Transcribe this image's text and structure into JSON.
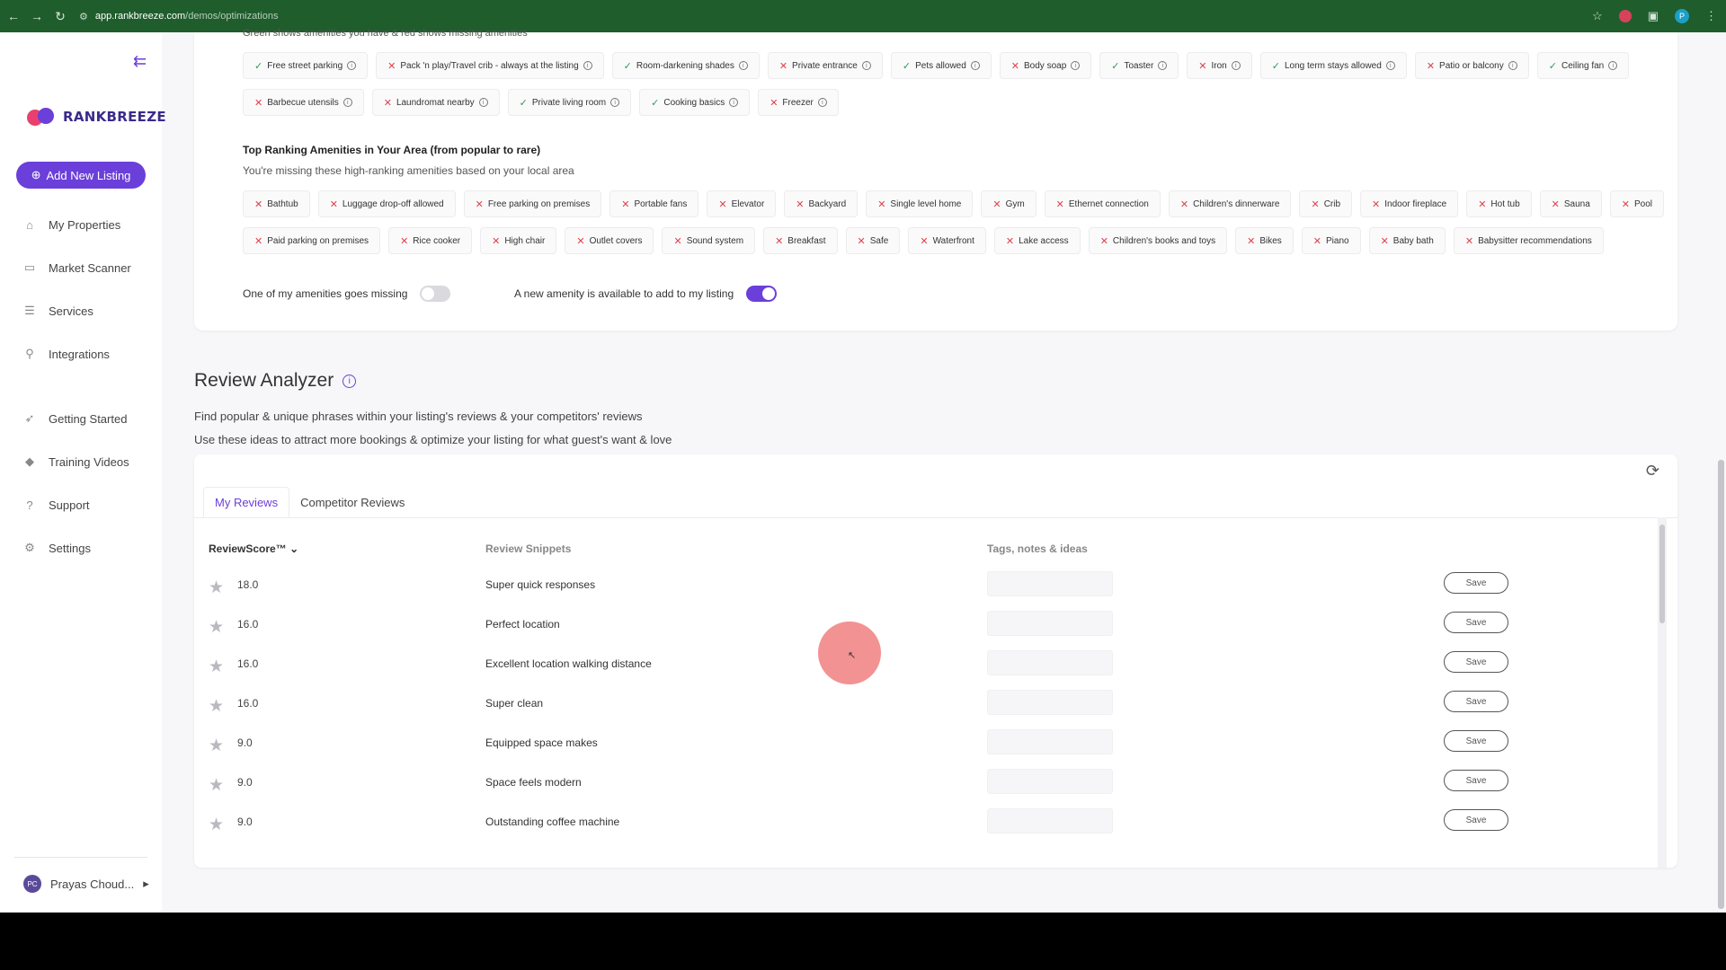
{
  "browser": {
    "url_host": "app.rankbreeze.com",
    "url_path": "/demos/optimizations",
    "profile_initial": "P"
  },
  "sidebar": {
    "logo_text": "RANKBREEZE",
    "add_listing": "Add New Listing",
    "items": [
      {
        "label": "My Properties",
        "icon": "home-icon"
      },
      {
        "label": "Market Scanner",
        "icon": "map-icon"
      },
      {
        "label": "Services",
        "icon": "list-icon"
      },
      {
        "label": "Integrations",
        "icon": "plug-icon"
      },
      {
        "label": "Getting Started",
        "icon": "rocket-icon"
      },
      {
        "label": "Training Videos",
        "icon": "graduation-icon"
      },
      {
        "label": "Support",
        "icon": "help-icon"
      },
      {
        "label": "Settings",
        "icon": "gear-icon"
      }
    ],
    "user_initials": "PC",
    "user_name": "Prayas Choud..."
  },
  "amenities": {
    "legend": "Green shows amenities you have & red shows missing amenities",
    "row1": [
      {
        "label": "Free street parking",
        "has": true
      },
      {
        "label": "Pack 'n play/Travel crib - always at the listing",
        "has": false
      },
      {
        "label": "Room-darkening shades",
        "has": true
      },
      {
        "label": "Private entrance",
        "has": false
      },
      {
        "label": "Pets allowed",
        "has": true
      },
      {
        "label": "Body soap",
        "has": false
      },
      {
        "label": "Toaster",
        "has": true
      },
      {
        "label": "Iron",
        "has": false
      },
      {
        "label": "Long term stays allowed",
        "has": true
      },
      {
        "label": "Patio or balcony",
        "has": false
      },
      {
        "label": "Ceiling fan",
        "has": true
      }
    ],
    "row2": [
      {
        "label": "Barbecue utensils",
        "has": false
      },
      {
        "label": "Laundromat nearby",
        "has": false
      },
      {
        "label": "Private living room",
        "has": true
      },
      {
        "label": "Cooking basics",
        "has": true
      },
      {
        "label": "Freezer",
        "has": false
      }
    ],
    "top_title": "Top Ranking Amenities in Your Area (from popular to rare)",
    "top_sub": "You're missing these high-ranking amenities based on your local area",
    "top_row1": [
      "Bathtub",
      "Luggage drop-off allowed",
      "Free parking on premises",
      "Portable fans",
      "Elevator",
      "Backyard",
      "Single level home",
      "Gym",
      "Ethernet connection",
      "Children's dinnerware",
      "Crib",
      "Indoor fireplace",
      "Hot tub",
      "Sauna",
      "Pool"
    ],
    "top_row2": [
      "Paid parking on premises",
      "Rice cooker",
      "High chair",
      "Outlet covers",
      "Sound system",
      "Breakfast",
      "Safe",
      "Waterfront",
      "Lake access",
      "Children's books and toys",
      "Bikes",
      "Piano",
      "Baby bath",
      "Babysitter recommendations"
    ],
    "toggle_missing": "One of my amenities goes missing",
    "toggle_missing_on": false,
    "toggle_new": "A new amenity is available to add to my listing",
    "toggle_new_on": true
  },
  "review_analyzer": {
    "title": "Review Analyzer",
    "desc1": "Find popular & unique phrases within your listing's reviews & your competitors' reviews",
    "desc2": "Use these ideas to attract more bookings & optimize your listing for what guest's want & love",
    "tabs": [
      "My Reviews",
      "Competitor Reviews"
    ],
    "active_tab": "My Reviews",
    "columns": {
      "score": "ReviewScore™",
      "snippets": "Review Snippets",
      "tags": "Tags, notes & ideas"
    },
    "save_label": "Save",
    "rows": [
      {
        "score": "18.0",
        "snippet": "Super quick responses"
      },
      {
        "score": "16.0",
        "snippet": "Perfect location"
      },
      {
        "score": "16.0",
        "snippet": "Excellent location walking distance"
      },
      {
        "score": "16.0",
        "snippet": "Super clean"
      },
      {
        "score": "9.0",
        "snippet": "Equipped space makes"
      },
      {
        "score": "9.0",
        "snippet": "Space feels modern"
      },
      {
        "score": "9.0",
        "snippet": "Outstanding coffee machine"
      }
    ]
  },
  "colors": {
    "accent": "#6b3fd9",
    "has_green": "#2e9a5b",
    "missing_red": "#e0414b",
    "browser_green": "#1f5d2c"
  }
}
